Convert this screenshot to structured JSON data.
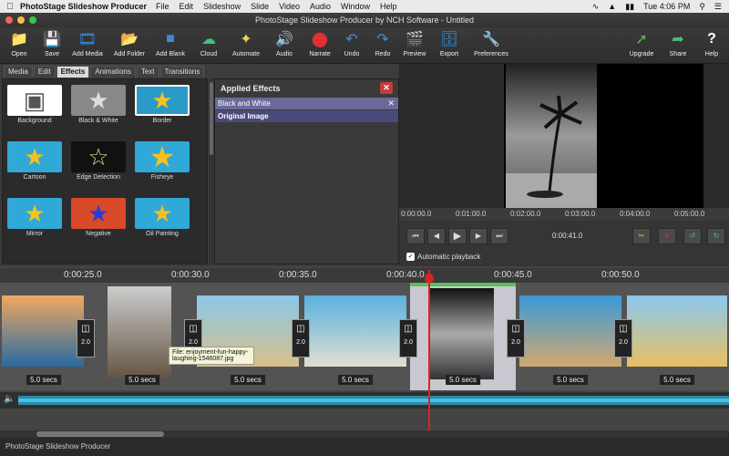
{
  "menubar": {
    "app_name": "PhotoStage Slideshow Producer",
    "items": [
      "File",
      "Edit",
      "Slideshow",
      "Slide",
      "Video",
      "Audio",
      "Window",
      "Help"
    ],
    "clock": "Tue 4:06 PM"
  },
  "window": {
    "title": "PhotoStage Slideshow Producer by NCH Software - Untitled"
  },
  "toolbar": {
    "buttons": [
      {
        "label": "Open",
        "icon": "folder-icon"
      },
      {
        "label": "Save",
        "icon": "save-icon"
      },
      {
        "label": "Add Media",
        "icon": "add-media-icon"
      },
      {
        "label": "Add Folder",
        "icon": "add-folder-icon"
      },
      {
        "label": "Add Blank",
        "icon": "add-blank-icon"
      },
      {
        "label": "Cloud",
        "icon": "cloud-icon"
      },
      {
        "label": "Automate",
        "icon": "wand-icon"
      },
      {
        "label": "Audio",
        "icon": "audio-icon"
      },
      {
        "label": "Narrate",
        "icon": "record-icon"
      },
      {
        "label": "Undo",
        "icon": "undo-icon"
      },
      {
        "label": "Redo",
        "icon": "redo-icon"
      },
      {
        "label": "Preview",
        "icon": "film-icon"
      },
      {
        "label": "Export",
        "icon": "export-icon"
      },
      {
        "label": "Preferences",
        "icon": "tools-icon"
      },
      {
        "label": "Upgrade",
        "icon": "upgrade-icon"
      },
      {
        "label": "Share",
        "icon": "share-icon"
      },
      {
        "label": "Help",
        "icon": "help-icon"
      }
    ]
  },
  "tabs": [
    "Media",
    "Edit",
    "Effects",
    "Animations",
    "Text",
    "Transitions"
  ],
  "active_tab": "Effects",
  "effects": [
    {
      "label": "Background"
    },
    {
      "label": "Black & White"
    },
    {
      "label": "Border"
    },
    {
      "label": "Cartoon"
    },
    {
      "label": "Edge Detection"
    },
    {
      "label": "Fisheye"
    },
    {
      "label": "Mirror"
    },
    {
      "label": "Negative"
    },
    {
      "label": "Oil Painting"
    }
  ],
  "applied": {
    "title": "Applied Effects",
    "items": [
      "Black and White",
      "Original Image"
    ]
  },
  "preview": {
    "ruler": [
      "0:00:00.0",
      "0:01:00.0",
      "0:02:00.0",
      "0:03:00.0",
      "0:04:00.0",
      "0:05:00.0"
    ],
    "time": "0:00:41.0",
    "auto_playback": "Automatic playback"
  },
  "timeline": {
    "ruler": [
      "0:00:25.0",
      "0:00:30.0",
      "0:00:35.0",
      "0:00:40.0",
      "0:00:45.0",
      "0:00:50.0"
    ],
    "slides": [
      {
        "secs": "5.0 secs"
      },
      {
        "secs": "5.0 secs"
      },
      {
        "secs": "5.0 secs"
      },
      {
        "secs": "5.0 secs"
      },
      {
        "secs": "5.0 secs"
      },
      {
        "secs": "5.0 secs"
      },
      {
        "secs": "5.0 secs"
      }
    ],
    "transitions": [
      "2.0",
      "2.0",
      "2.0",
      "2.0",
      "2.0",
      "2.0"
    ],
    "tooltip": "File: enjoyment-fun-happy-laughing-1546087.jpg"
  },
  "status": "PhotoStage Slideshow Producer"
}
